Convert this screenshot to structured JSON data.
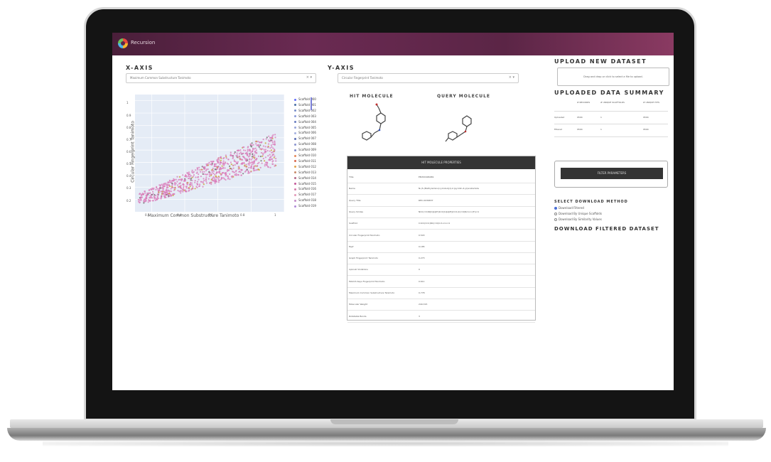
{
  "app": {
    "brand": "Recursion"
  },
  "x_axis": {
    "title": "X-AXIS",
    "selected": "Maximum Common Substructure Tanimoto",
    "clear_icon": "×",
    "arrow_icon": "▾"
  },
  "y_axis": {
    "title": "Y-AXIS",
    "selected": "Circular Fingerprint Tanimoto",
    "clear_icon": "×",
    "arrow_icon": "▾"
  },
  "chart_data": {
    "type": "scatter",
    "xlabel": "Maximum Common Substructure Tanimoto",
    "ylabel": "Circular Fingerprint Tanimoto",
    "xlim": [
      0.1,
      1.0
    ],
    "ylim": [
      0.1,
      1.05
    ],
    "x_ticks": [
      "0.2",
      "0.4",
      "0.6",
      "0.8",
      "1"
    ],
    "y_ticks": [
      "0.2",
      "0.3",
      "0.4",
      "0.5",
      "0.6",
      "0.7",
      "0.8",
      "0.9",
      "1"
    ],
    "legend": [
      "Scaffold 000",
      "Scaffold 001",
      "Scaffold 002",
      "Scaffold 003",
      "Scaffold 004",
      "Scaffold 005",
      "Scaffold 006",
      "Scaffold 007",
      "Scaffold 008",
      "Scaffold 009",
      "Scaffold 010",
      "Scaffold 011",
      "Scaffold 012",
      "Scaffold 013",
      "Scaffold 014",
      "Scaffold 015",
      "Scaffold 016",
      "Scaffold 017",
      "Scaffold 018",
      "Scaffold 019"
    ],
    "legend_colors": [
      "#636efa",
      "#4a6fa5",
      "#7a8fc9",
      "#8a9ad8",
      "#6b7fc0",
      "#9aa6d9",
      "#a4b0e0",
      "#5c6fb5",
      "#8b95cf",
      "#7f8ac9",
      "#e58a5b",
      "#d9694f",
      "#e0a34f",
      "#c98a6a",
      "#b36a8a",
      "#c45a9a",
      "#d47aaa",
      "#e39ab9",
      "#c48fc9",
      "#b08ad9"
    ]
  },
  "molecules": {
    "hit_title": "HIT MOLECULE",
    "query_title": "QUERY MOLECULE"
  },
  "properties": {
    "title": "HIT MOLECULE PROPERTIES",
    "rows": [
      {
        "key": "Title",
        "value": "EN300496069"
      },
      {
        "key": "Name",
        "value": "N-(3-(Methylamino)cyclobutyl)-2-(pyridin-4-yl)acetamide"
      },
      {
        "key": "Query Title",
        "value": "REC-0036837"
      },
      {
        "key": "Query Smiles",
        "value": "NCC(=O)N[C@@H]1CC[C@@H](CC1)C(=O)Nc1ccc(F)cc1"
      },
      {
        "key": "Scaffold",
        "value": "C1CC(CC1)NC(=O)Cc1ccncc1"
      },
      {
        "key": "Circular Fingerprint Tanimoto",
        "value": "0.543"
      },
      {
        "key": "Espf",
        "value": "0.185"
      },
      {
        "key": "Graph Fingerprint Tanimoto",
        "value": "0.273"
      },
      {
        "key": "Lipinski Violations",
        "value": "0"
      },
      {
        "key": "MACCS Keys Fingerprint Tanimoto",
        "value": "0.611"
      },
      {
        "key": "Maximum Common Substructure Tanimoto",
        "value": "0.778"
      },
      {
        "key": "Molecular Weight",
        "value": "249.315"
      },
      {
        "key": "Rotatable Bonds",
        "value": "3"
      }
    ]
  },
  "upload": {
    "title": "UPLOAD NEW DATASET",
    "dropzone": "Drag and drop or click to select a file to upload."
  },
  "summary": {
    "title": "UPLOADED DATA SUMMARY",
    "headers": [
      "",
      "# RECORDS",
      "# UNIQUE SCAFFOLDS",
      "# UNIQUE HITS"
    ],
    "rows": [
      [
        "Uploaded",
        "9594",
        "1",
        "9594"
      ],
      [
        "Filtered",
        "9594",
        "1",
        "9594"
      ]
    ]
  },
  "filter": {
    "button": "FILTER PARAMETERS"
  },
  "download": {
    "method_title": "SELECT DOWNLOAD METHOD",
    "options": [
      "Download Filtered",
      "Download By Unique Scaffolds",
      "Download By Similarity Values"
    ],
    "selected_index": 0,
    "dataset_title": "DOWNLOAD FILTERED DATASET"
  }
}
